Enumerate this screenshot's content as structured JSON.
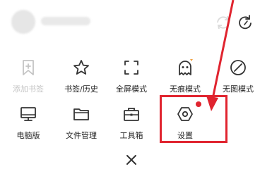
{
  "menu": {
    "rows": [
      [
        {
          "label": "添加书签",
          "icon": "bookmark-add-icon",
          "enabled": false
        },
        {
          "label": "书签/历史",
          "icon": "star-icon",
          "enabled": true
        },
        {
          "label": "全屏模式",
          "icon": "fullscreen-icon",
          "enabled": true
        },
        {
          "label": "无痕模式",
          "icon": "ghost-icon",
          "enabled": true
        },
        {
          "label": "无图模式",
          "icon": "no-image-icon",
          "enabled": true
        }
      ],
      [
        {
          "label": "电脑版",
          "icon": "monitor-icon",
          "enabled": true
        },
        {
          "label": "文件管理",
          "icon": "folder-icon",
          "enabled": true
        },
        {
          "label": "工具箱",
          "icon": "toolbox-icon",
          "enabled": true
        },
        {
          "label": "设置",
          "icon": "settings-hexagon-icon",
          "enabled": true,
          "badge": "notification-dot"
        }
      ]
    ]
  },
  "header": {
    "avatar": "user-avatar",
    "username": "",
    "sync_icon": "sync-icon",
    "refresh_icon": "refresh-icon"
  },
  "footer": {
    "close_icon": "close-icon"
  },
  "annotation": {
    "color": "#e0242f",
    "target": "设置"
  },
  "colors": {
    "icon": "#333333",
    "disabled": "#c4c4c4",
    "accent": "#e0242f",
    "ghost_badge": "#f0a040"
  }
}
